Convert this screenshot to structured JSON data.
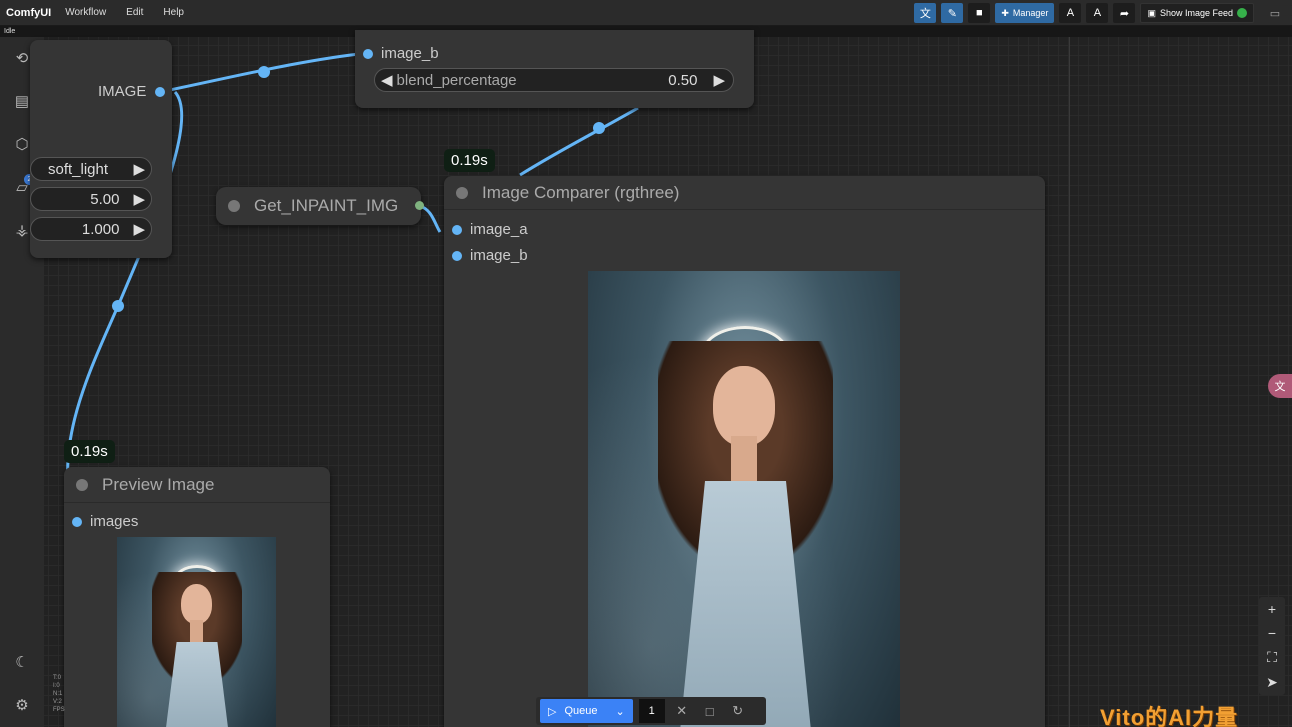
{
  "app": {
    "brand": "ComfyUI",
    "menu": [
      "Workflow",
      "Edit",
      "Help"
    ],
    "status": "Idle"
  },
  "toolbar": {
    "manager_label": "Manager",
    "feed_label": "Show Image Feed"
  },
  "sidebar": {
    "queue_badge": "2",
    "icons": [
      "history-icon",
      "node-library-icon",
      "model-library-icon",
      "workflows-icon",
      "templates-icon",
      "theme-icon",
      "settings-icon"
    ]
  },
  "nodes": {
    "blend_top": {
      "input": "image_b",
      "widget_label": "blend_percentage",
      "widget_value": "0.50"
    },
    "blend_left": {
      "output": "IMAGE",
      "mode": "soft_light",
      "value1": "5.00",
      "value2": "1.000"
    },
    "get_node": {
      "title": "Get_INPAINT_IMG"
    },
    "comparer": {
      "time": "0.19s",
      "title": "Image Comparer (rgthree)",
      "input_a": "image_a",
      "input_b": "image_b"
    },
    "preview": {
      "time": "0.19s",
      "title": "Preview Image",
      "input": "images"
    }
  },
  "queue": {
    "label": "Queue",
    "count": "1"
  },
  "overlay": {
    "watermark": "Vito的AI力量"
  },
  "colors": {
    "link": "#64b5f6",
    "accent": "#3b82f6",
    "node_bg": "#353535",
    "canvas": "#222222"
  }
}
